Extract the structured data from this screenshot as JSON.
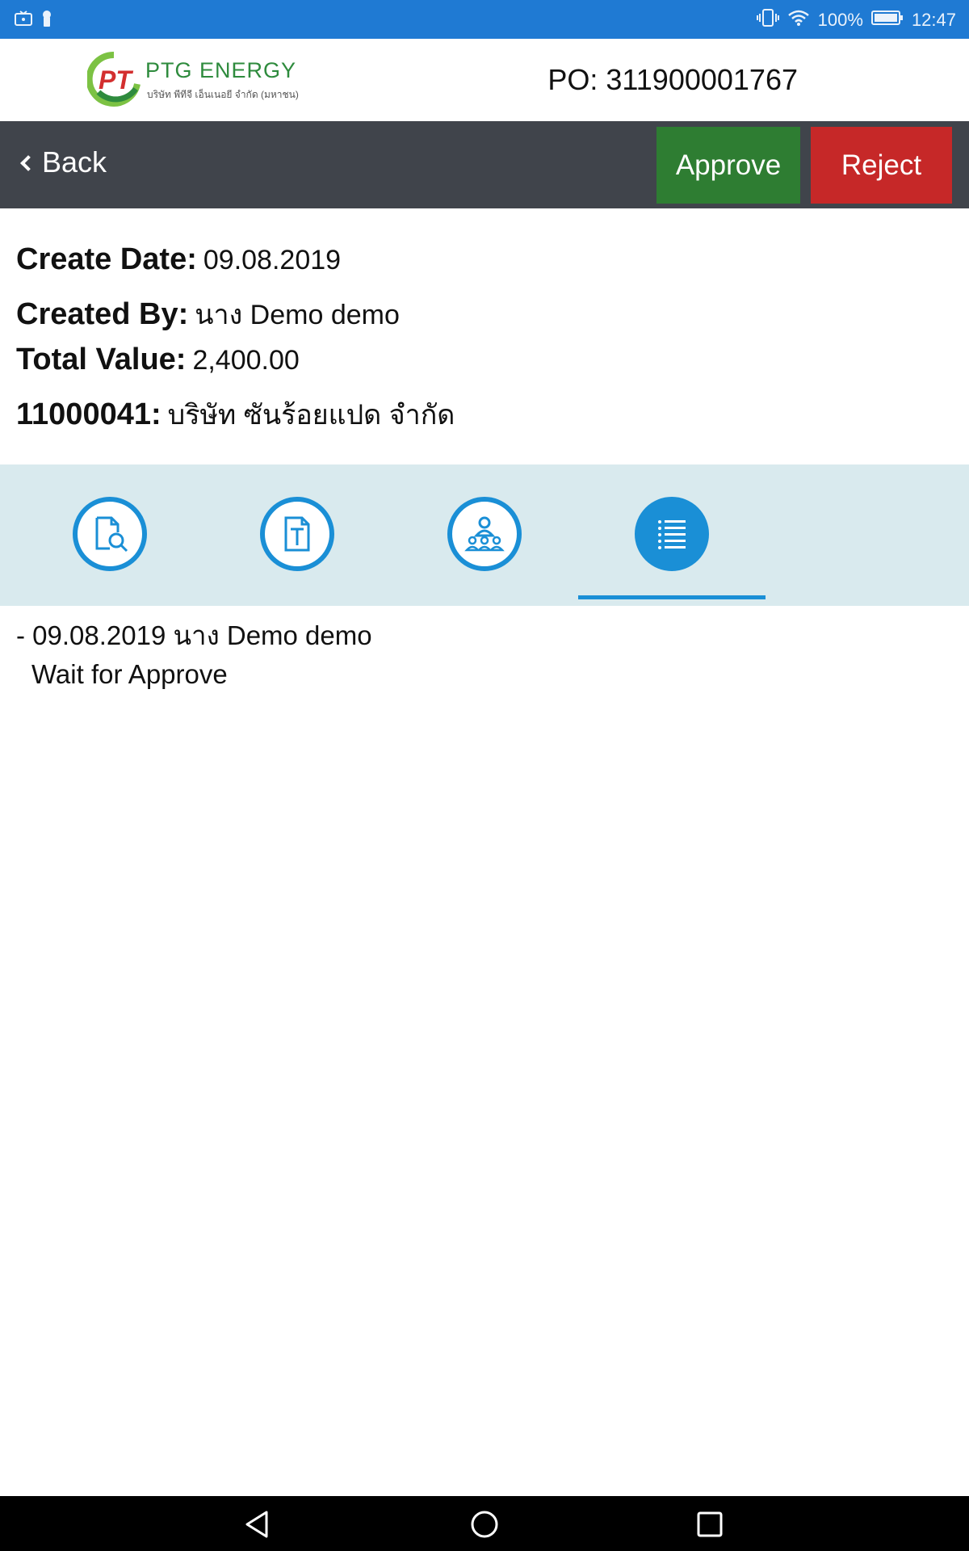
{
  "status_bar": {
    "battery": "100%",
    "time": "12:47",
    "icons": [
      "notification-icon",
      "lock-icon",
      "vibrate-icon",
      "wifi-icon",
      "battery-icon"
    ]
  },
  "header": {
    "logo_name": "PTG ENERGY",
    "logo_subtitle": "บริษัท พีทีจี เอ็นเนอยี จำกัด (มหาชน)",
    "po_label": "PO: 311900001767"
  },
  "toolbar": {
    "back_label": "Back",
    "approve_label": "Approve",
    "reject_label": "Reject",
    "approve_color": "#2e7d32",
    "reject_color": "#c62828"
  },
  "info": {
    "create_date_label": "Create Date:",
    "create_date_value": "09.08.2019",
    "created_by_label": "Created By:",
    "created_by_value": "นาง Demo demo",
    "total_value_label": "Total Value:",
    "total_value_value": "2,400.00",
    "vendor_code_label": "11000041:",
    "vendor_name": "บริษัท ซันร้อยแปด จำกัด"
  },
  "tabs": {
    "items": [
      {
        "icon": "document-search-icon"
      },
      {
        "icon": "text-document-icon"
      },
      {
        "icon": "people-group-icon"
      },
      {
        "icon": "list-icon"
      }
    ],
    "active_index": 3,
    "accent_color": "#1a8fd6"
  },
  "history": {
    "entry_header": "- 09.08.2019 นาง Demo demo",
    "entry_status": "Wait for Approve"
  }
}
